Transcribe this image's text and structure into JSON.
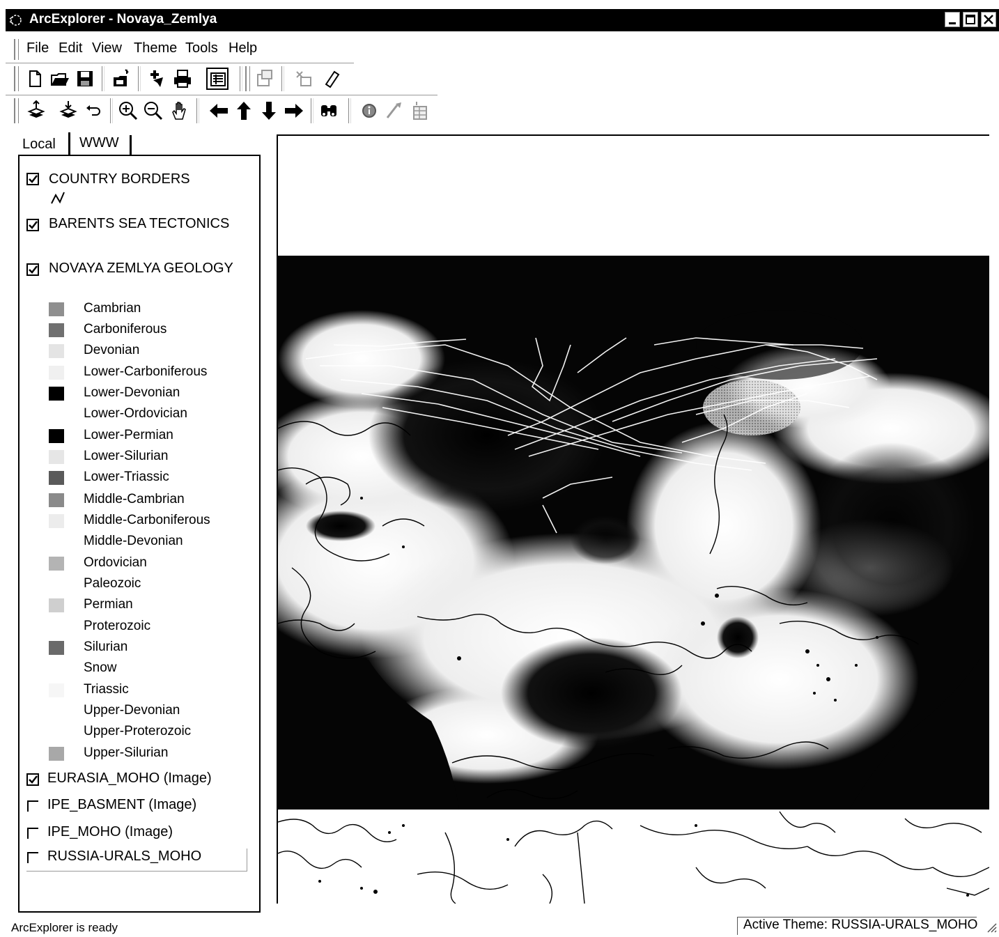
{
  "window": {
    "title": "ArcExplorer - Novaya_Zemlya"
  },
  "menu": [
    "File",
    "Edit",
    "View",
    "Theme",
    "Tools",
    "Help"
  ],
  "toolbar1": [
    "new-map-icon",
    "open-icon",
    "save-icon",
    "import-icon",
    "add-theme-icon",
    "print-icon",
    "legend-icon",
    "properties-icon",
    "query-icon",
    "erase-icon"
  ],
  "toolbar2": [
    "theme-up-icon",
    "theme-down-icon",
    "undo-icon",
    "zoom-in-icon",
    "zoom-out-icon",
    "pan-icon",
    "pan-left-icon",
    "pan-up-icon",
    "pan-down-icon",
    "pan-right-icon",
    "find-icon",
    "identify-icon",
    "measure-icon",
    "table-icon"
  ],
  "tabs": [
    "Local",
    "WWW"
  ],
  "layers": {
    "country_borders": {
      "label": "COUNTRY BORDERS",
      "checked": true
    },
    "barents": {
      "label": "BARENTS SEA TECTONICS",
      "checked": true
    },
    "novaya": {
      "label": "NOVAYA ZEMLYA GEOLOGY",
      "checked": true
    },
    "eurasia": {
      "label": "EURASIA_MOHO (Image)",
      "checked": true
    },
    "ipe_basment": {
      "label": "IPE_BASMENT (Image)",
      "checked": false
    },
    "ipe_moho": {
      "label": "IPE_MOHO (Image)",
      "checked": false
    },
    "russia": {
      "label": "RUSSIA-URALS_MOHO",
      "checked": false
    }
  },
  "legend": [
    {
      "label": "Cambrian",
      "color": "#8f8f8f"
    },
    {
      "label": "Carboniferous",
      "color": "#707070"
    },
    {
      "label": "Devonian",
      "color": "#e4e4e4"
    },
    {
      "label": "Lower-Carboniferous",
      "color": "#f0f0f0"
    },
    {
      "label": "Lower-Devonian",
      "color": "#000000"
    },
    {
      "label": "Lower-Ordovician",
      "color": "#ffffff"
    },
    {
      "label": "Lower-Permian",
      "color": "#000000"
    },
    {
      "label": "Lower-Silurian",
      "color": "#e6e6e6"
    },
    {
      "label": "Lower-Triassic",
      "color": "#5a5a5a"
    },
    {
      "label": "Middle-Cambrian",
      "color": "#8a8a8a"
    },
    {
      "label": "Middle-Carboniferous",
      "color": "#ececec"
    },
    {
      "label": "Middle-Devonian",
      "color": "#ffffff"
    },
    {
      "label": "Ordovician",
      "color": "#b4b4b4"
    },
    {
      "label": "Paleozoic",
      "color": "#ffffff"
    },
    {
      "label": "Permian",
      "color": "#cfcfcf"
    },
    {
      "label": "Proterozoic",
      "color": "#ffffff"
    },
    {
      "label": "Silurian",
      "color": "#6a6a6a"
    },
    {
      "label": "Snow",
      "color": "#ffffff"
    },
    {
      "label": "Triassic",
      "color": "#f6f6f6"
    },
    {
      "label": "Upper-Devonian",
      "color": "#ffffff"
    },
    {
      "label": "Upper-Proterozoic",
      "color": "#ffffff"
    },
    {
      "label": "Upper-Silurian",
      "color": "#a8a8a8"
    }
  ],
  "status": {
    "message": "ArcExplorer is ready",
    "active_theme": "Active Theme: RUSSIA-URALS_MOHO"
  }
}
